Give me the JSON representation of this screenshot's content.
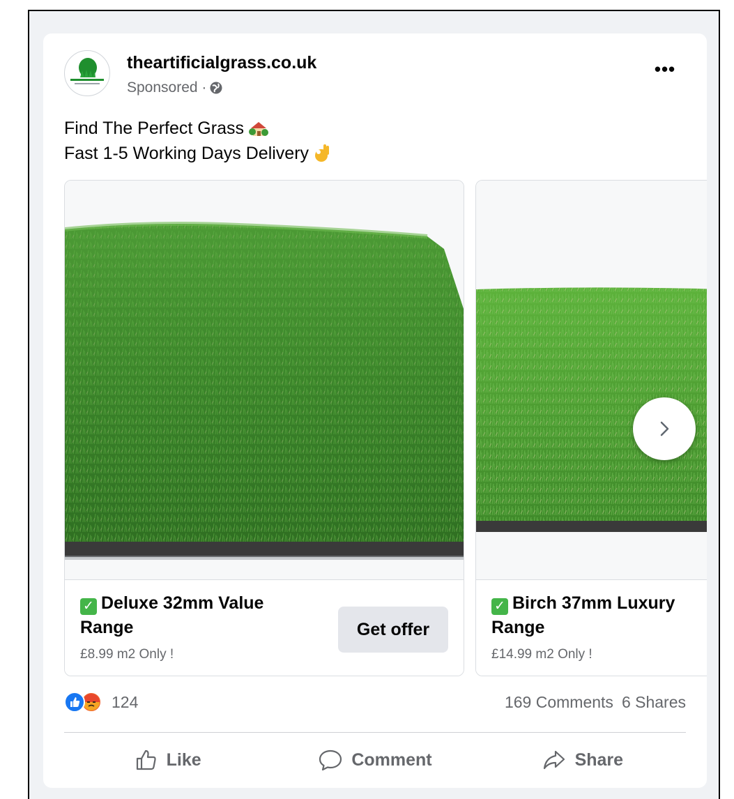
{
  "post": {
    "page_name": "theartificialgrass.co.uk",
    "sponsored_label": "Sponsored ·",
    "more_label": "•••",
    "caption_line1": "Find The Perfect Grass",
    "caption_line2": "Fast 1-5 Working Days Delivery"
  },
  "carousel": {
    "items": [
      {
        "title": "Deluxe 32mm Value Range",
        "price": "£8.99 m2 Only !",
        "cta": "Get offer"
      },
      {
        "title": "Birch 37mm Luxury Range",
        "price": "£14.99 m2 Only !"
      }
    ]
  },
  "engagement": {
    "reaction_count": "124",
    "comments": "169 Comments",
    "shares": "6 Shares"
  },
  "actions": {
    "like": "Like",
    "comment": "Comment",
    "share": "Share"
  },
  "icons": {
    "globe": "globe-icon",
    "check": "check-icon",
    "next": "chevron-right-icon",
    "like": "thumbs-up-icon",
    "comment": "speech-bubble-icon",
    "share": "share-arrow-icon"
  },
  "colors": {
    "primary_text": "#050505",
    "secondary_text": "#65676b",
    "button_bg": "#e4e6eb",
    "like_blue": "#1877f2",
    "angry_orange": "#f0622e",
    "check_green": "#44b549",
    "grass_green": "#3f8a2a"
  }
}
